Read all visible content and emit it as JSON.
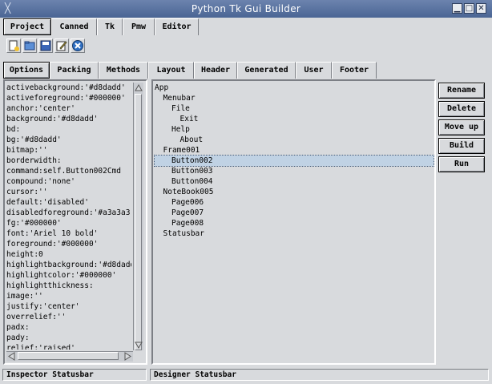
{
  "window": {
    "title": "Python Tk Gui Builder"
  },
  "top_tabs": [
    {
      "label": "Project"
    },
    {
      "label": "Canned"
    },
    {
      "label": "Tk"
    },
    {
      "label": "Pmw"
    },
    {
      "label": "Editor"
    }
  ],
  "toolbar_icons": [
    "new-file-icon",
    "open-folder-icon",
    "save-icon",
    "edit-icon",
    "close-circle-icon"
  ],
  "inspector_tabs": [
    {
      "label": "Options"
    },
    {
      "label": "Packing"
    },
    {
      "label": "Methods"
    },
    {
      "label": "Layout"
    },
    {
      "label": "Header"
    },
    {
      "label": "Generated"
    },
    {
      "label": "User"
    },
    {
      "label": "Footer"
    }
  ],
  "options": [
    "activebackground:'#d8dadd'",
    "activeforeground:'#000000'",
    "anchor:'center'",
    "background:'#d8dadd'",
    "bd:",
    "bg:'#d8dadd'",
    "bitmap:''",
    "borderwidth:",
    "command:self.Button002Cmd",
    "compound:'none'",
    "cursor:''",
    "default:'disabled'",
    "disabledforeground:'#a3a3a3'",
    "fg:'#000000'",
    "font:'Ariel 10 bold'",
    "foreground:'#000000'",
    "height:0",
    "highlightbackground:'#d8dadd",
    "highlightcolor:'#000000'",
    "highlightthickness:",
    "image:''",
    "justify:'center'",
    "overrelief:''",
    "padx:",
    "pady:",
    "relief:'raised'"
  ],
  "tree": [
    {
      "label": "App",
      "level": 0
    },
    {
      "label": "Menubar",
      "level": 1
    },
    {
      "label": "File",
      "level": 2
    },
    {
      "label": "Exit",
      "level": 3
    },
    {
      "label": "Help",
      "level": 2
    },
    {
      "label": "About",
      "level": 3
    },
    {
      "label": "Frame001",
      "level": 1
    },
    {
      "label": "Button002",
      "level": 2,
      "selected": true
    },
    {
      "label": "Button003",
      "level": 2
    },
    {
      "label": "Button004",
      "level": 2
    },
    {
      "label": "NoteBook005",
      "level": 1
    },
    {
      "label": "Page006",
      "level": 2
    },
    {
      "label": "Page007",
      "level": 2
    },
    {
      "label": "Page008",
      "level": 2
    },
    {
      "label": "Statusbar",
      "level": 1
    }
  ],
  "side_buttons": [
    {
      "label": "Rename"
    },
    {
      "label": "Delete"
    },
    {
      "label": "Move up"
    },
    {
      "label": "Build"
    },
    {
      "label": "Run"
    }
  ],
  "status": {
    "inspector": "Inspector Statusbar",
    "designer": "Designer Statusbar"
  },
  "colors": {
    "titlebar": "#4a6594",
    "background": "#d8dadd",
    "selection": "#c0d2e4"
  }
}
